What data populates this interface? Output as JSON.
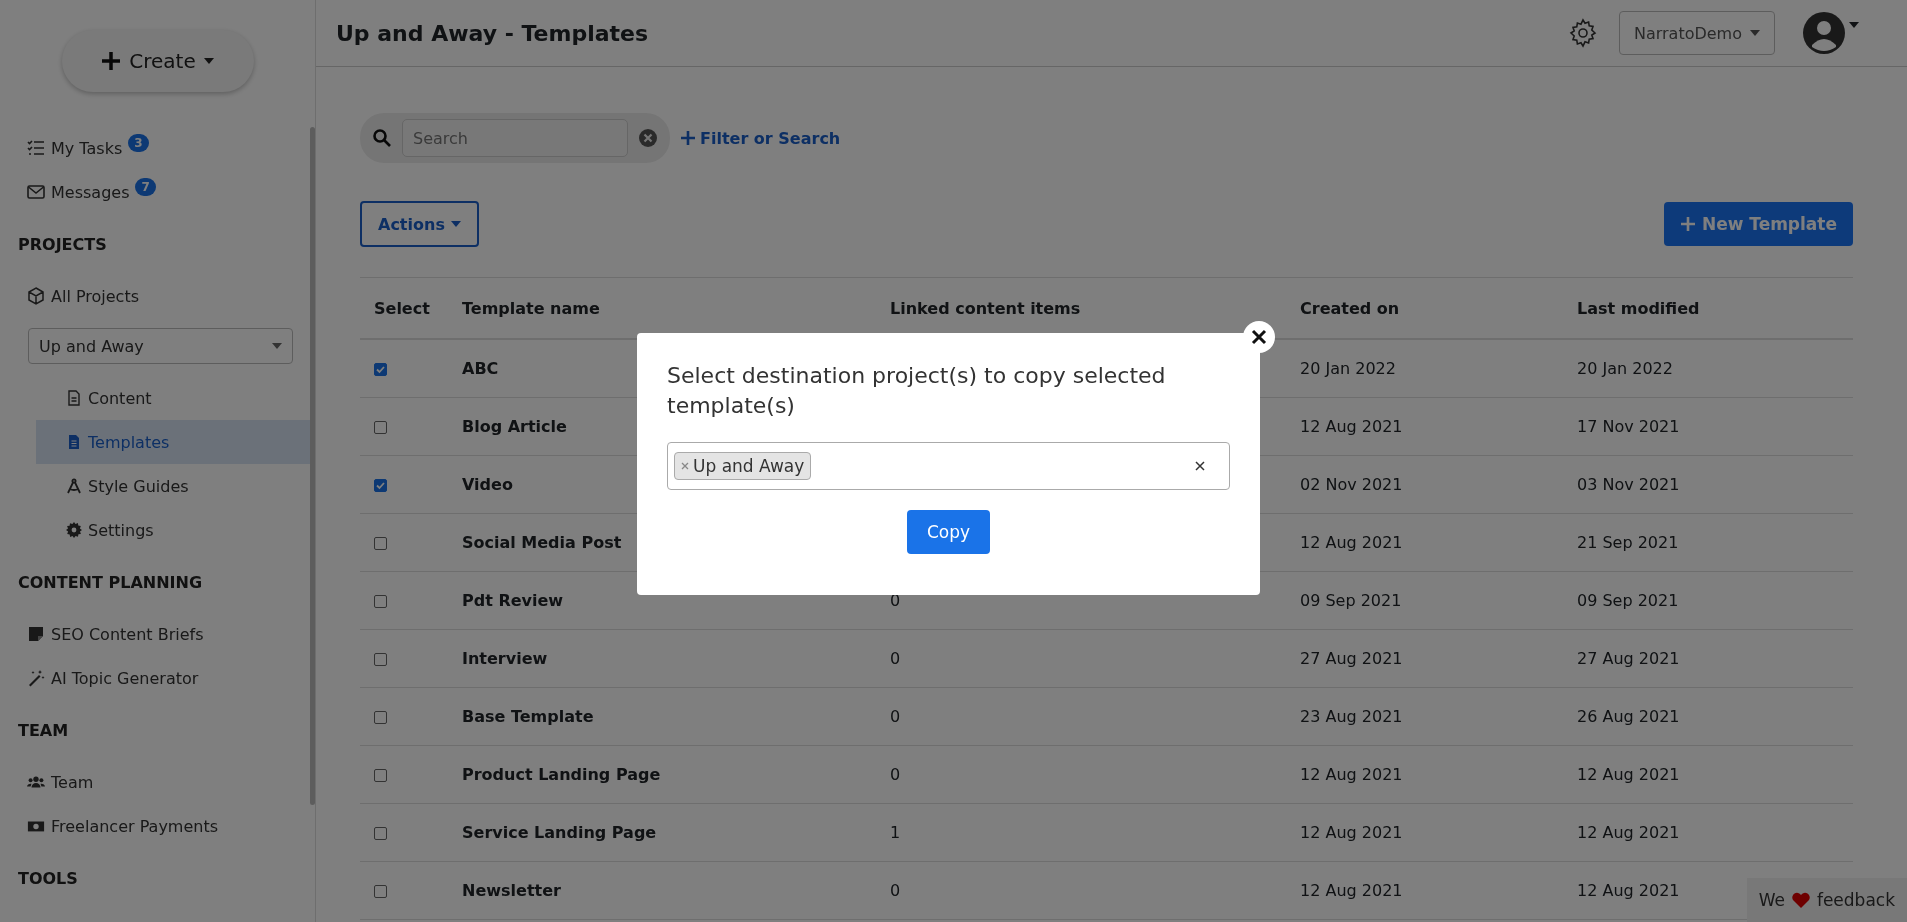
{
  "sidebar": {
    "create_label": "Create",
    "nav": [
      {
        "kind": "link",
        "label": "My Tasks",
        "badge": "3",
        "selected": false
      },
      {
        "kind": "link",
        "label": "Messages",
        "badge": "7",
        "selected": false
      },
      {
        "kind": "heading",
        "label": "PROJECTS"
      },
      {
        "kind": "link",
        "label": "All Projects",
        "selected": false
      },
      {
        "kind": "select",
        "value": "Up and Away",
        "children": [
          {
            "label": "Content",
            "selected": false
          },
          {
            "label": "Templates",
            "selected": true
          },
          {
            "label": "Style Guides",
            "selected": false
          },
          {
            "label": "Settings",
            "selected": false
          }
        ]
      },
      {
        "kind": "heading",
        "label": "CONTENT PLANNING"
      },
      {
        "kind": "link",
        "label": "SEO Content Briefs",
        "selected": false
      },
      {
        "kind": "link",
        "label": "AI Topic Generator",
        "selected": false
      },
      {
        "kind": "heading",
        "label": "TEAM"
      },
      {
        "kind": "link",
        "label": "Team",
        "selected": false
      },
      {
        "kind": "link",
        "label": "Freelancer Payments",
        "selected": false
      },
      {
        "kind": "heading",
        "label": "TOOLS"
      }
    ]
  },
  "header": {
    "title": "Up and Away - Templates",
    "account": "NarratoDemo"
  },
  "toolbar": {
    "search": {
      "placeholder": "Search"
    },
    "filter_link": "Filter or Search",
    "actions_button": "Actions",
    "new_button": "New Template"
  },
  "table": {
    "columns": [
      "Select",
      "Template name",
      "Linked content items",
      "Created on",
      "Last modified"
    ],
    "rows": [
      {
        "selected": true,
        "name": "ABC",
        "created": "20 Jan 2022",
        "modified": "20 Jan 2022"
      },
      {
        "selected": false,
        "name": "Blog Article",
        "created": "12 Aug 2021",
        "modified": "17 Nov 2021"
      },
      {
        "selected": true,
        "name": "Video",
        "created": "02 Nov 2021",
        "modified": "03 Nov 2021"
      },
      {
        "selected": false,
        "name": "Social Media Post",
        "created": "12 Aug 2021",
        "modified": "21 Sep 2021"
      },
      {
        "selected": false,
        "name": "Pdt Review",
        "linked": "0",
        "created": "09 Sep 2021",
        "modified": "09 Sep 2021"
      },
      {
        "selected": false,
        "name": "Interview",
        "linked": "0",
        "created": "27 Aug 2021",
        "modified": "27 Aug 2021"
      },
      {
        "selected": false,
        "name": "Base Template",
        "linked": "0",
        "created": "23 Aug 2021",
        "modified": "26 Aug 2021"
      },
      {
        "selected": false,
        "name": "Product Landing Page",
        "linked": "0",
        "created": "12 Aug 2021",
        "modified": "12 Aug 2021"
      },
      {
        "selected": false,
        "name": "Service Landing Page",
        "linked": "1",
        "created": "12 Aug 2021",
        "modified": "12 Aug 2021"
      },
      {
        "selected": false,
        "name": "Newsletter",
        "linked": "0",
        "created": "12 Aug 2021",
        "modified": "12 Aug 2021"
      }
    ]
  },
  "modal": {
    "title": "Select destination project(s) to copy selected template(s)",
    "tags": [
      {
        "label": "Up and Away"
      }
    ],
    "button": "Copy"
  },
  "feedback": {
    "before": "We",
    "after": "feedback"
  }
}
